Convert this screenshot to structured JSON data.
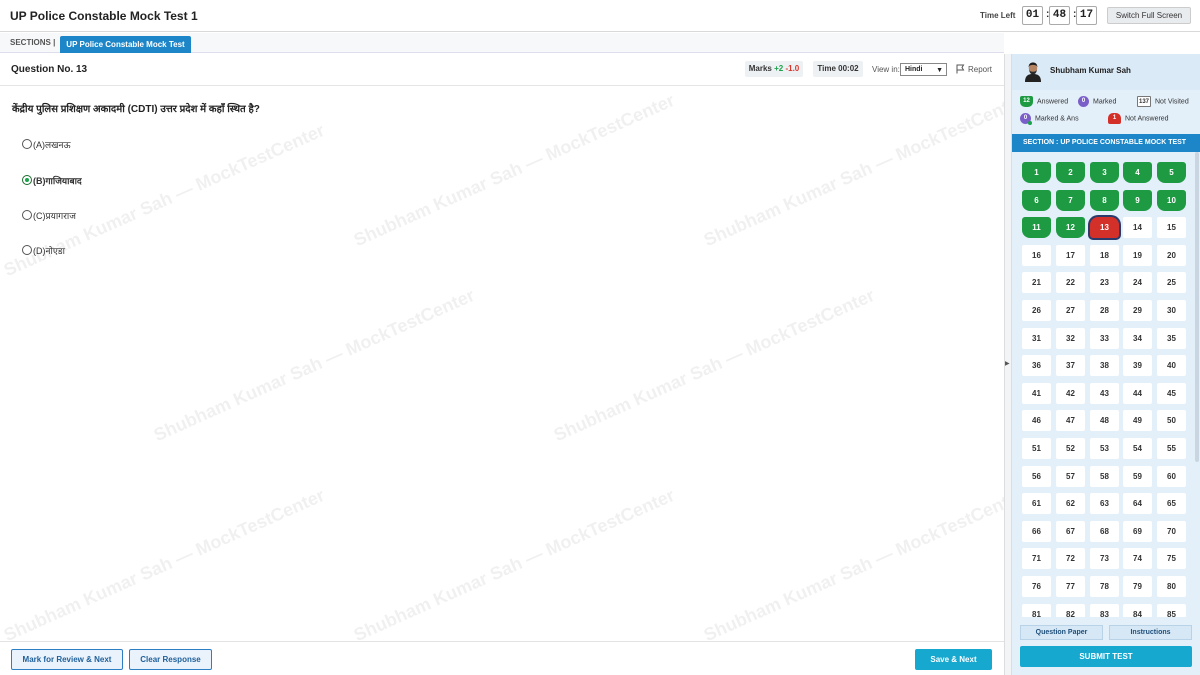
{
  "header": {
    "title": "UP Police Constable Mock Test 1",
    "time_left_label": "Time Left",
    "timer": {
      "hours": "01",
      "minutes": "48",
      "seconds": "17",
      "separator": ":"
    },
    "fullscreen_label": "Switch Full Screen"
  },
  "sections": {
    "label": "SECTIONS |",
    "active_tab": "UP Police Constable Mock Test"
  },
  "question": {
    "number_label": "Question No. 13",
    "marks_label": "Marks",
    "marks_positive": "+2",
    "marks_negative": "-1.0",
    "time_label": "Time 00:02",
    "view_in_label": "View in:",
    "language": "Hindi",
    "report_label": "Report",
    "text": "केंद्रीय पुलिस प्रशिक्षण अकादमी (CDTI) उत्तर प्रदेश में कहाँ स्थित है?",
    "options": [
      {
        "label": "(A)लखनऊ",
        "selected": false
      },
      {
        "label": "(B)गाजियाबाद",
        "selected": true
      },
      {
        "label": "(C)प्रयागराज",
        "selected": false
      },
      {
        "label": "(D)नोएडा",
        "selected": false
      }
    ]
  },
  "watermark": "Shubham Kumar Sah — MockTestCenter",
  "footer": {
    "mark_review_label": "Mark for Review & Next",
    "clear_label": "Clear Response",
    "save_next_label": "Save & Next"
  },
  "panel": {
    "user_name": "Shubham Kumar Sah",
    "legend": {
      "answered_count": "12",
      "answered_label": "Answered",
      "marked_count": "0",
      "marked_label": "Marked",
      "not_visited_count": "137",
      "not_visited_label": "Not Visited",
      "marked_ans_count": "0",
      "marked_ans_label": "Marked & Ans",
      "not_answered_count": "1",
      "not_answered_label": "Not Answered"
    },
    "section_title": "SECTION : UP POLICE CONSTABLE MOCK TEST",
    "answered_questions": [
      1,
      2,
      3,
      4,
      5,
      6,
      7,
      8,
      9,
      10,
      11,
      12
    ],
    "not_answered_questions": [
      13
    ],
    "current_question": 13,
    "visible_questions_max": 85,
    "question_paper_label": "Question Paper",
    "instructions_label": "Instructions",
    "submit_label": "SUBMIT TEST"
  },
  "colors": {
    "answered": "#1e9a43",
    "not_answered": "#d3302a",
    "marked": "#7b5fc9",
    "accent": "#1c86c8",
    "save_button": "#17a8d0"
  }
}
